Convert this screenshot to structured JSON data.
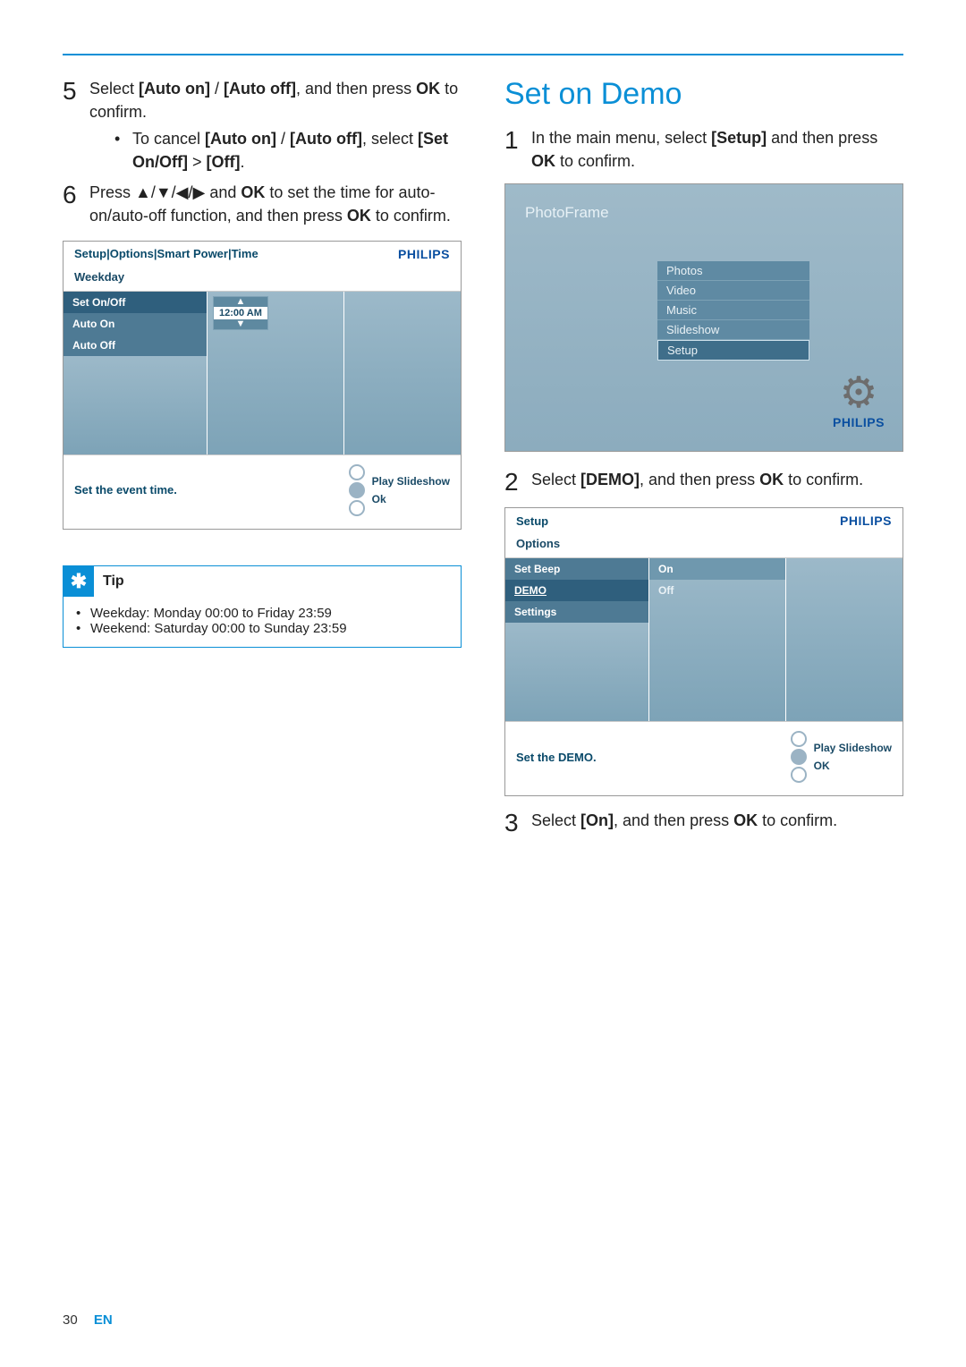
{
  "page": {
    "number": "30",
    "lang": "EN"
  },
  "left": {
    "step5": {
      "num": "5",
      "parts": [
        "Select ",
        "[Auto on]",
        " / ",
        "[Auto off]",
        ", and then press ",
        "OK",
        " to confirm."
      ],
      "sub": {
        "dot": "•",
        "parts": [
          "To cancel ",
          "[Auto on]",
          " / ",
          "[Auto off]",
          ", select ",
          "[Set On/Off]",
          " > ",
          "[Off]",
          "."
        ]
      }
    },
    "step6": {
      "num": "6",
      "parts_a": "Press ",
      "arrows": "▲/▼/◀/▶",
      "parts_b": " and ",
      "ok": "OK",
      "parts_c": " to set the time for auto-on/auto-off function, and then press ",
      "ok2": "OK",
      "parts_d": " to confirm."
    },
    "device": {
      "breadcrumb": "Setup|Options|Smart Power|Time",
      "brand": "PHILIPS",
      "subbar": "Weekday",
      "leftItems": [
        "Set On/Off",
        "Auto On",
        "Auto Off"
      ],
      "spin": {
        "up": "▲",
        "value": "12:00 AM",
        "down": "▼"
      },
      "hint": "Set the event time.",
      "play": "Play Slideshow",
      "ok": "Ok"
    },
    "tip": {
      "label": "Tip",
      "lines": [
        "Weekday: Monday 00:00 to Friday 23:59",
        "Weekend: Saturday 00:00 to Sunday 23:59"
      ],
      "dot": "•"
    }
  },
  "right": {
    "heading": "Set on Demo",
    "step1": {
      "num": "1",
      "parts": [
        "In the main menu, select ",
        "[Setup]",
        " and then press ",
        "OK",
        " to confirm."
      ]
    },
    "pf": {
      "title": "PhotoFrame",
      "items": [
        "Photos",
        "Video",
        "Music",
        "Slideshow",
        "Setup"
      ],
      "brand": "PHILIPS"
    },
    "step2": {
      "num": "2",
      "parts": [
        "Select ",
        "[DEMO]",
        ", and then press ",
        "OK",
        " to confirm."
      ]
    },
    "device2": {
      "breadcrumb": "Setup",
      "brand": "PHILIPS",
      "subbar": "Options",
      "leftItems": [
        "Set Beep",
        "DEMO",
        "Settings"
      ],
      "midItems": [
        "On",
        "Off"
      ],
      "hint": "Set the DEMO.",
      "play": "Play Slideshow",
      "ok": "OK"
    },
    "step3": {
      "num": "3",
      "parts": [
        "Select ",
        "[On]",
        ", and then press ",
        "OK",
        " to confirm."
      ]
    }
  }
}
